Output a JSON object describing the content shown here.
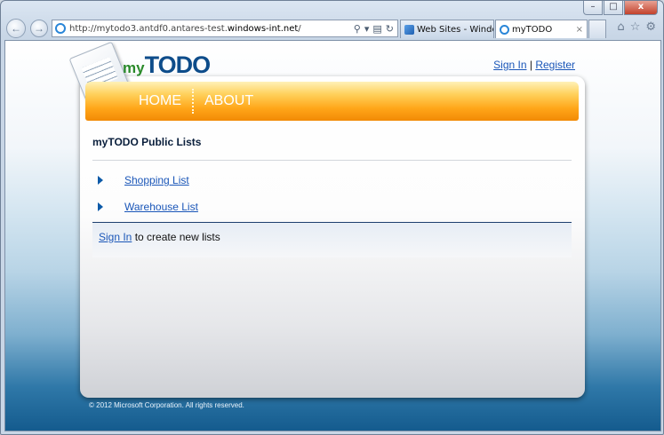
{
  "browser": {
    "window_controls": {
      "minimize": "–",
      "maximize": "□",
      "close": "x"
    },
    "address_prefix": "http://mytodo3.antdf0.antares-test.",
    "address_domain": "windows-int.net",
    "address_suffix": "/",
    "address_tools": {
      "search": "⚲",
      "dropdown": "▾",
      "compat": "▤",
      "refresh": "↻"
    },
    "tabs": [
      {
        "label": "Web Sites - Window...",
        "active": false
      },
      {
        "label": "myTODO",
        "active": true,
        "close": "×"
      }
    ],
    "toolbar_icons": {
      "home": "⌂",
      "favorites": "☆",
      "tools": "⚙"
    },
    "nav": {
      "back": "←",
      "forward": "→"
    }
  },
  "page": {
    "logo": {
      "my": "my",
      "todo": "TODO"
    },
    "auth": {
      "sign_in": "Sign In",
      "separator": " | ",
      "register": "Register"
    },
    "nav": {
      "home": "HOME",
      "about": "ABOUT"
    },
    "section_title": "myTODO Public Lists",
    "lists": [
      {
        "label": "Shopping List"
      },
      {
        "label": "Warehouse List"
      }
    ],
    "signin_prompt": {
      "link": "Sign In",
      "text": " to create new lists"
    },
    "footer": "© 2012 Microsoft Corporation. All rights reserved."
  },
  "colors": {
    "nav_orange": "#f28a05",
    "link_blue": "#1a56b8",
    "logo_green": "#2a8a2a",
    "logo_blue": "#0d4c8a"
  }
}
